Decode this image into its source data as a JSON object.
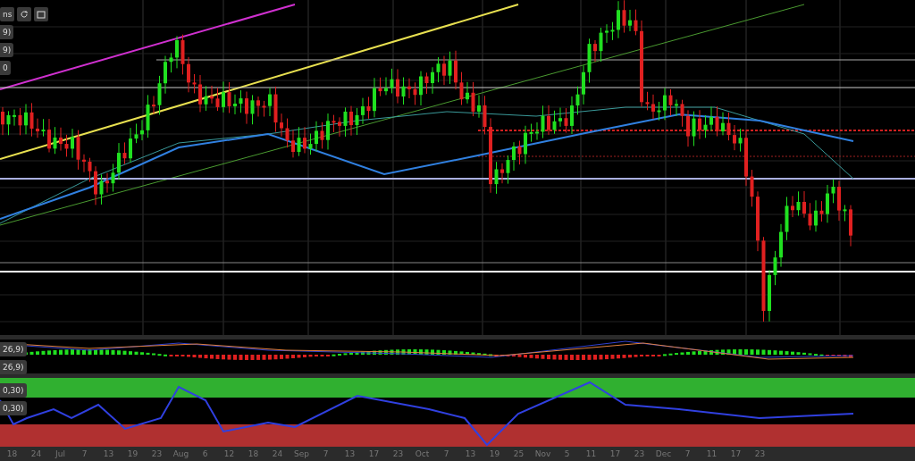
{
  "toolbar": {
    "label": "ns"
  },
  "main_panel": {
    "labels": [
      "9)",
      "9)",
      "0"
    ]
  },
  "macd_panel": {
    "labels": [
      "26,9)",
      "26,9)"
    ]
  },
  "rsi_panel": {
    "labels": [
      "0,30)",
      "0,30)"
    ]
  },
  "x_axis": [
    "18",
    "24",
    "Jul",
    "7",
    "13",
    "19",
    "23",
    "Aug",
    "6",
    "12",
    "18",
    "24",
    "Sep",
    "7",
    "13",
    "17",
    "23",
    "Oct",
    "7",
    "13",
    "19",
    "25",
    "Nov",
    "5",
    "11",
    "17",
    "23",
    "Dec",
    "7",
    "11",
    "17",
    "23"
  ]
}
